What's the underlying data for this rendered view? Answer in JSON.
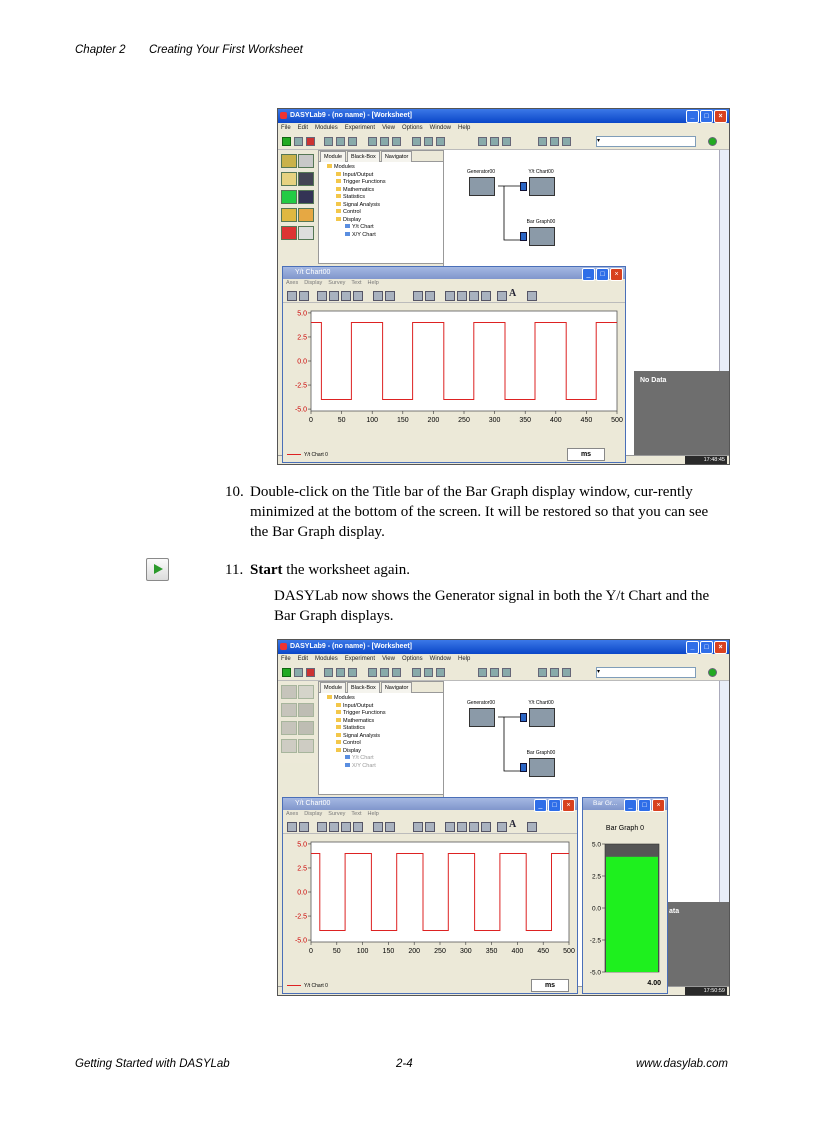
{
  "header": {
    "chapter": "Chapter 2",
    "title": "Creating Your First Worksheet"
  },
  "footer": {
    "left": "Getting Started with DASYLab",
    "center": "2-4",
    "right": "www.dasylab.com"
  },
  "steps": [
    {
      "number": "10.",
      "text": "Double-click on the Title bar of the Bar Graph display window, cur-rently minimized at the bottom of the screen. It will be restored so that you can see the Bar Graph display."
    },
    {
      "number": "11.",
      "bold": "Start",
      "text": " the worksheet again."
    }
  ],
  "step11_paragraph": "DASYLab now shows the Generator signal in both the Y/t Chart and the Bar Graph displays.",
  "screenshot": {
    "window_title": "DASYLab9 - (no name) - [Worksheet]",
    "menu": [
      "File",
      "Edit",
      "Modules",
      "Experiment",
      "View",
      "Options",
      "Window",
      "Help"
    ],
    "tabs": [
      "Module",
      "Black-Box",
      "Navigator"
    ],
    "tree": [
      {
        "label": "Modules",
        "level": 0
      },
      {
        "label": "Input/Output",
        "level": 1
      },
      {
        "label": "Trigger Functions",
        "level": 1
      },
      {
        "label": "Mathematics",
        "level": 1
      },
      {
        "label": "Statistics",
        "level": 1
      },
      {
        "label": "Signal Analysis",
        "level": 1
      },
      {
        "label": "Control",
        "level": 1
      },
      {
        "label": "Display",
        "level": 1
      },
      {
        "label": "Y/t Chart",
        "level": 2
      },
      {
        "label": "X/Y Chart",
        "level": 2
      }
    ],
    "modules": {
      "generator": "Generator00",
      "ytchart": "Y/t Chart00",
      "bargraph": "Bar Graph00"
    },
    "chart_window_title": "Y/t Chart00",
    "chart_menu": [
      "Axes",
      "Display",
      "Survey",
      "Text",
      "Help"
    ],
    "no_data": "No Data",
    "time1": "17:48:45",
    "time2": "17:50:59",
    "legend": "Y/t Chart 0",
    "unit": "ms",
    "bar_window_title": "Bar Gr...",
    "bar_graph_label": "Bar Graph 0",
    "bar_value": "4.00",
    "bar_ticks": [
      "5.0",
      "2.5",
      "0.0",
      "-2.5",
      "-5.0"
    ],
    "partial_label": "ata"
  },
  "chart_data": [
    {
      "type": "line",
      "x": [
        0,
        17,
        17,
        66,
        66,
        117,
        117,
        166,
        166,
        217,
        217,
        266,
        266,
        317,
        317,
        366,
        366,
        417,
        417,
        466,
        466,
        500
      ],
      "y": [
        4,
        4,
        -4,
        -4,
        4,
        4,
        -4,
        -4,
        4,
        4,
        -4,
        -4,
        4,
        4,
        -4,
        -4,
        4,
        4,
        -4,
        -4,
        4,
        4
      ],
      "xticks": [
        0,
        50,
        100,
        150,
        200,
        250,
        300,
        350,
        400,
        450,
        500
      ],
      "yticks": [
        5.0,
        2.5,
        0.0,
        -2.5,
        -5.0
      ],
      "xlim": [
        0,
        500
      ],
      "ylim": [
        -5.2,
        5.2
      ],
      "xlabel": "ms",
      "legend": [
        "Y/t Chart 0"
      ],
      "grid": false
    },
    {
      "type": "bar",
      "categories": [
        "Bar Graph 0"
      ],
      "values": [
        4.0
      ],
      "ylim": [
        -5,
        5
      ],
      "yticks": [
        5.0,
        2.5,
        0.0,
        -2.5,
        -5.0
      ]
    }
  ]
}
